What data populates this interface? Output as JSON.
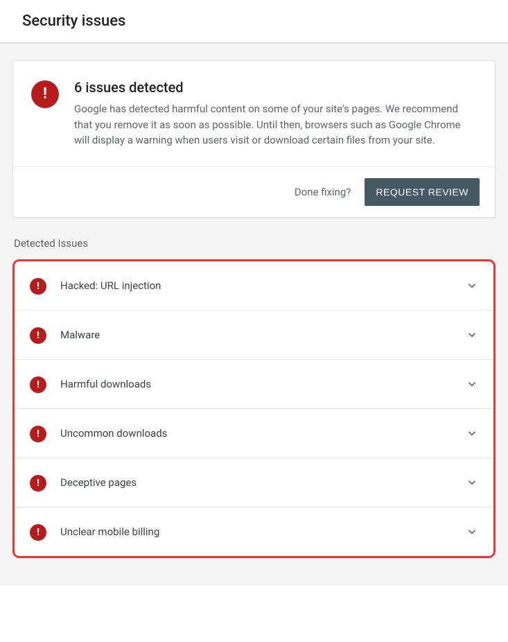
{
  "header": {
    "title": "Security issues"
  },
  "alert": {
    "title": "6 issues detected",
    "description": "Google has detected harmful content on some of your site's pages. We recommend that you remove it as soon as possible. Until then, browsers such as Google Chrome will display a warning when users visit or download certain files from your site.",
    "done_prompt": "Done fixing?",
    "request_button": "REQUEST REVIEW"
  },
  "section_label": "Detected Issues",
  "issues": [
    {
      "label": "Hacked: URL injection"
    },
    {
      "label": "Malware"
    },
    {
      "label": "Harmful downloads"
    },
    {
      "label": "Uncommon downloads"
    },
    {
      "label": "Deceptive pages"
    },
    {
      "label": "Unclear mobile billing"
    }
  ]
}
